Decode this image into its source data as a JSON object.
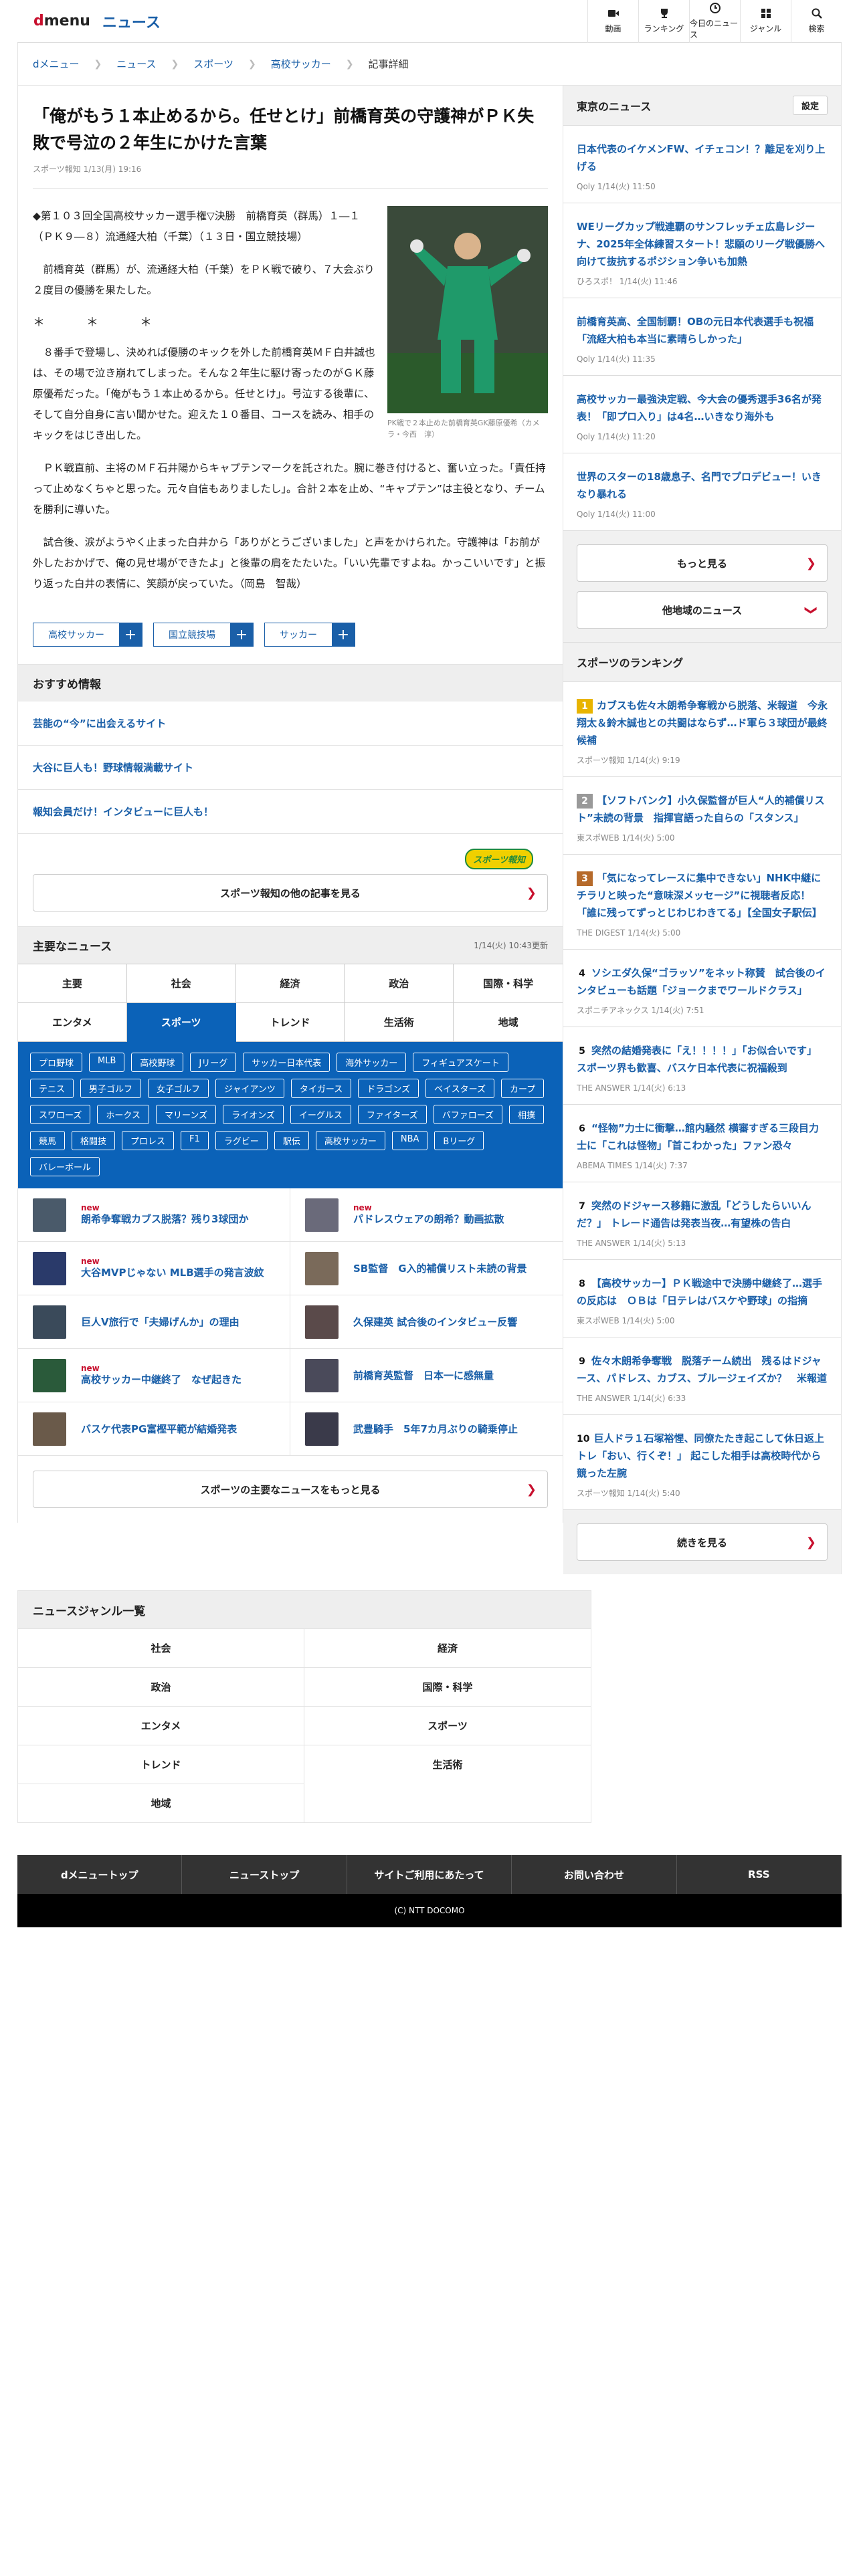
{
  "header": {
    "logo_d": "d",
    "logo_menu": "menu",
    "section": "ニュース",
    "nav": [
      {
        "label": "動画",
        "icon": "video-icon"
      },
      {
        "label": "ランキング",
        "icon": "trophy-icon"
      },
      {
        "label": "今日のニュース",
        "icon": "clock-icon"
      },
      {
        "label": "ジャンル",
        "icon": "grid-icon"
      },
      {
        "label": "検索",
        "icon": "search-icon"
      }
    ]
  },
  "breadcrumb": [
    "dメニュー",
    "ニュース",
    "スポーツ",
    "高校サッカー",
    "記事詳細"
  ],
  "article": {
    "title": "「俺がもう１本止めるから。任せとけ」前橋育英の守護神がＰＫ失敗で号泣の２年生にかけた言葉",
    "meta": "スポーツ報知 1/13(月) 19:16",
    "caption": "PK戦で２本止めた前橋育英GK藤原優希（カメラ・今西　淳）",
    "paragraphs": [
      "◆第１０３回全国高校サッカー選手権▽決勝　前橋育英（群馬）１―１（ＰＫ９―８）流通経大柏（千葉）（１３日・国立競技場）",
      "前橋育英（群馬）が、流通経大柏（千葉）をＰＫ戦で破り、７大会ぶり２度目の優勝を果たした。",
      "８番手で登場し、決めれば優勝のキックを外した前橋育英ＭＦ白井誠也は、その場で泣き崩れてしまった。そんな２年生に駆け寄ったのがＧＫ藤原優希だった。「俺がもう１本止めるから。任せとけ」。号泣する後輩に、そして自分自身に言い聞かせた。迎えた１０番目、コースを読み、相手のキックをはじき出した。",
      "ＰＫ戦直前、主将のＭＦ石井陽からキャプテンマークを託された。腕に巻き付けると、奮い立った。「責任持って止めなくちゃと思った。元々自信もありましたし」。合計２本を止め、“キャプテン”は主役となり、チームを勝利に導いた。",
      "試合後、涙がようやく止まった白井から「ありがとうございました」と声をかけられた。守護神は「お前が外したおかげで、俺の見せ場ができたよ」と後輩の肩をたたいた。「いい先輩ですよね。かっこいいです」と振り返った白井の表情に、笑顔が戻っていた。（岡島　智哉）"
    ],
    "stars": "＊　＊　＊",
    "tags": [
      "高校サッカー",
      "国立競技場",
      "サッカー"
    ]
  },
  "recommend": {
    "title": "おすすめ情報",
    "items": [
      "芸能の“今”に出会えるサイト",
      "大谷に巨人も！野球情報満載サイト",
      "報知会員だけ！インタビューに巨人も！"
    ],
    "badge": "スポーツ報知",
    "more": "スポーツ報知の他の記事を見る"
  },
  "major": {
    "title": "主要なニュース",
    "updated": "1/14(火) 10:43更新",
    "tabs": [
      "主要",
      "社会",
      "経済",
      "政治",
      "国際・科学",
      "エンタメ",
      "スポーツ",
      "トレンド",
      "生活術",
      "地域"
    ],
    "chips": [
      "プロ野球",
      "MLB",
      "高校野球",
      "Jリーグ",
      "サッカー日本代表",
      "海外サッカー",
      "フィギュアスケート",
      "テニス",
      "男子ゴルフ",
      "女子ゴルフ",
      "ジャイアンツ",
      "タイガース",
      "ドラゴンズ",
      "ベイスターズ",
      "カープ",
      "スワローズ",
      "ホークス",
      "マリーンズ",
      "ライオンズ",
      "イーグルス",
      "ファイターズ",
      "バファローズ",
      "相撲",
      "競馬",
      "格闘技",
      "プロレス",
      "F1",
      "ラグビー",
      "駅伝",
      "高校サッカー",
      "NBA",
      "Bリーグ",
      "バレーボール"
    ],
    "new": "new",
    "items": [
      {
        "text": "朗希争奪戦カブス脱落？残り3球団か",
        "new": true
      },
      {
        "text": "パドレスウェアの朗希？動画拡散",
        "new": true
      },
      {
        "text": "大谷MVPじゃない MLB選手の発言波紋",
        "new": true
      },
      {
        "text": "SB監督　G入的補償リスト未読の背景",
        "new": false
      },
      {
        "text": "巨人V旅行で「夫婦げんか」の理由",
        "new": false
      },
      {
        "text": "久保建英 試合後のインタビュー反響",
        "new": false
      },
      {
        "text": "高校サッカー中継終了　なぜ起きた",
        "new": true
      },
      {
        "text": "前橋育英監督　日本一に感無量",
        "new": false
      },
      {
        "text": "バスケ代表PG富樫平範が結婚発表",
        "new": false
      },
      {
        "text": "武豊騎手　5年7カ月ぶりの騎乗停止",
        "new": false
      }
    ],
    "more": "スポーツの主要なニュースをもっと見る"
  },
  "tokyo": {
    "title": "東京のニュース",
    "setting": "設定",
    "items": [
      {
        "t": "日本代表のイケメンFW、イチェコン！？離足を刈り上げる",
        "m": "Qoly 1/14(火) 11:50"
      },
      {
        "t": "WEリーグカップ戦連覇のサンフレッチェ広島レジーナ、2025年全体練習スタート！悲願のリーグ戦優勝へ向けて抜抗するポジション争いも加熱",
        "m": "ひろスポ！ 1/14(火) 11:46"
      },
      {
        "t": "前橋育英高、全国制覇！OBの元日本代表選手も祝福「流経大柏も本当に素晴らしかった」",
        "m": "Qoly 1/14(火) 11:35"
      },
      {
        "t": "高校サッカー最強決定戦、今大会の優秀選手36名が発表！「即プロ入り」は4名…いきなり海外も",
        "m": "Qoly 1/14(火) 11:20"
      },
      {
        "t": "世界のスターの18歳息子、名門でプロデビュー！いきなり暴れる",
        "m": "Qoly 1/14(火) 11:00"
      }
    ],
    "more": "もっと見る",
    "other": "他地域のニュース"
  },
  "ranking": {
    "title": "スポーツのランキング",
    "items": [
      {
        "n": "1",
        "t": "カブスも佐々木朗希争奪戦から脱落、米報道　今永翔太＆鈴木誠也との共闘はならず…ド軍ら３球団が最終候補",
        "m": "スポーツ報知 1/14(火) 9:19"
      },
      {
        "n": "2",
        "t": "【ソフトバンク】小久保監督が巨人“人的補償リスト”未読の背景　指揮官語った自らの「スタンス」",
        "m": "東スポWEB 1/14(火) 5:00"
      },
      {
        "n": "3",
        "t": "「気になってレースに集中できない」NHK中継にチラリと映った“意味深メッセージ”に視聴者反応！「誰に残ってずっとじわじわきてる」【全国女子駅伝】",
        "m": "THE DIGEST 1/14(火) 5:00"
      },
      {
        "n": "4",
        "t": "ソシエダ久保“ゴラッソ”をネット称賛　試合後のインタビューも話題「ジョークまでワールドクラス」",
        "m": "スポニチアネックス 1/14(火) 7:51"
      },
      {
        "n": "5",
        "t": "突然の結婚発表に「え！！！！」「お似合いです」 スポーツ界も歓喜、バスケ日本代表に祝福殺到",
        "m": "THE ANSWER 1/14(火) 6:13"
      },
      {
        "n": "6",
        "t": "“怪物”力士に衝撃…館内騒然 横審すぎる三段目力士に「これは怪物」「首こわかった」ファン恐々",
        "m": "ABEMA TIMES 1/14(火) 7:37"
      },
      {
        "n": "7",
        "t": "突然のドジャース移籍に激乱「どうしたらいいんだ？」 トレード通告は発表当夜…有望株の告白",
        "m": "THE ANSWER 1/14(火) 5:13"
      },
      {
        "n": "8",
        "t": "【高校サッカー】ＰＫ戦途中で決勝中継終了…選手の反応は　ＯＢは「日テレはバスケや野球」の指摘",
        "m": "東スポWEB 1/14(火) 5:00"
      },
      {
        "n": "9",
        "t": "佐々木朗希争奪戦　脱落チーム続出　残るはドジャース、パドレス、カブス、ブルージェイズか？　米報道",
        "m": "THE ANSWER 1/14(火) 6:33"
      },
      {
        "n": "10",
        "t": "巨人ドラ１石塚裕惺、同僚たたき起こして休日返上トレ「おい、行くぞ！」 起こした相手は高校時代から競った左腕",
        "m": "スポーツ報知 1/14(火) 5:40"
      }
    ],
    "more": "続きを見る"
  },
  "genre": {
    "title": "ニュースジャンル一覧",
    "items": [
      "社会",
      "経済",
      "政治",
      "国際・科学",
      "エンタメ",
      "スポーツ",
      "トレンド",
      "生活術",
      "地域"
    ]
  },
  "footer": {
    "links": [
      "dメニュートップ",
      "ニューストップ",
      "サイトご利用にあたって",
      "お問い合わせ",
      "RSS"
    ],
    "copy": "(C) NTT DOCOMO"
  }
}
